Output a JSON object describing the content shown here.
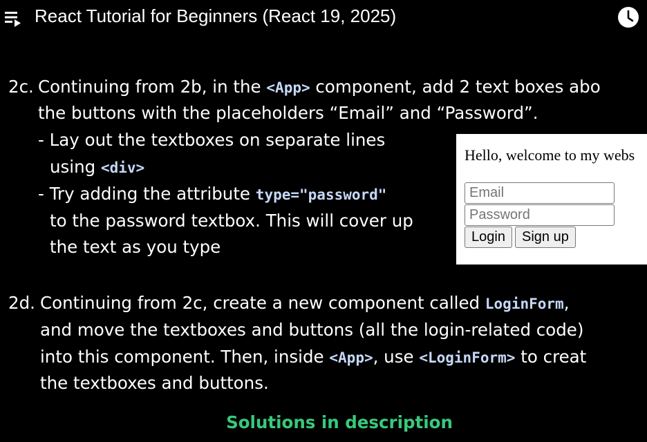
{
  "header": {
    "title": "React Tutorial for Beginners (React 19, 2025)",
    "playlist_icon": "playlist-play-icon",
    "watch_later_icon": "clock-icon"
  },
  "slide": {
    "exercise_2c": {
      "number": "2c.",
      "line1_pre": "Continuing from 2b, in the ",
      "line1_code": "<App>",
      "line1_post": " component, add 2 text boxes abo",
      "line2": "the buttons with the placeholders “Email” and “Password”.",
      "bullet1_line1": "- Lay out the textboxes on separate lines",
      "bullet1_line2_pre": "using ",
      "bullet1_line2_code": "<div>",
      "bullet2_line1_pre": "- Try adding the attribute ",
      "bullet2_line1_code": "type=\"password\"",
      "bullet2_line2": "to the password textbox. This will cover up",
      "bullet2_line3": "the text as you type"
    },
    "exercise_2d": {
      "number": "2d.",
      "line1_pre": "Continuing from 2c, create a new component called ",
      "line1_code": "LoginForm",
      "line1_post": ",",
      "line2": "and move the textboxes and buttons (all the login-related code)",
      "line3_pre": "into this component. Then, inside ",
      "line3_code1": "<App>",
      "line3_mid": ", use ",
      "line3_code2": "<LoginForm>",
      "line3_post": " to creat",
      "line4": "the textboxes and buttons."
    },
    "solutions": "Solutions in description",
    "preview": {
      "greeting": "Hello, welcome to my webs",
      "email_placeholder": "Email",
      "password_placeholder": "Password",
      "login_label": "Login",
      "signup_label": "Sign up"
    }
  },
  "colors": {
    "background": "#000000",
    "code": "#c6d8f8",
    "solutions": "#38c97b"
  }
}
